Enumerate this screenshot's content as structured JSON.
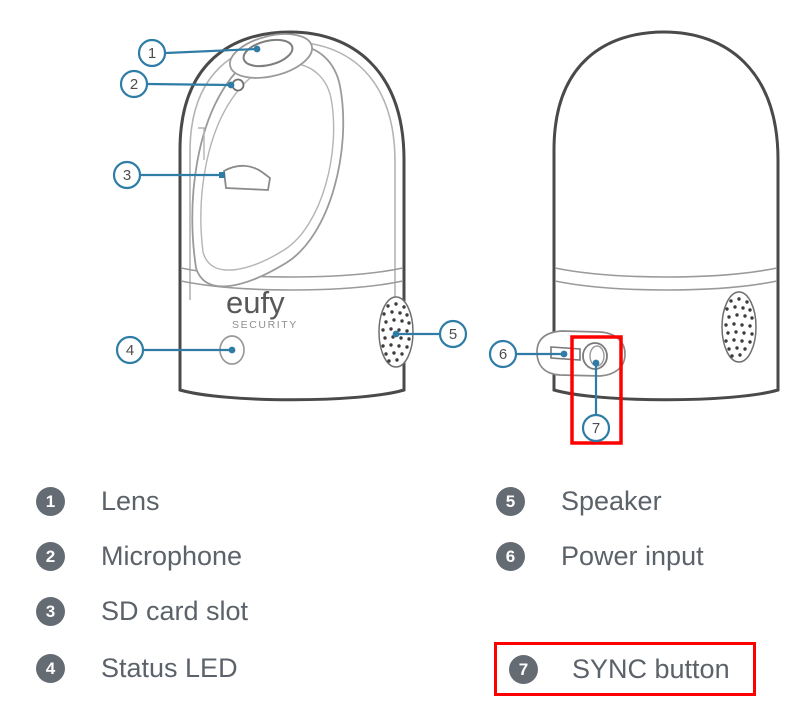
{
  "document": {
    "type": "product-parts-diagram",
    "product_brand": "eufy",
    "product_sub_brand": "SECURITY"
  },
  "colors": {
    "callout_stroke": "#2f7da6",
    "leader_line": "#2f7da6",
    "badge_bg": "#656b73",
    "badge_text": "#ffffff",
    "label_text": "#5c626a",
    "highlight_box": "#fe0000",
    "outline_dark": "#4a4a4a",
    "outline_light": "#9a9a9a",
    "background": "#ffffff"
  },
  "diagram": {
    "front_view": {
      "name": "front-view",
      "brand_text": "eufy",
      "sub_brand_text": "SECURITY",
      "callouts": [
        {
          "number": "1",
          "part": "lens"
        },
        {
          "number": "2",
          "part": "microphone"
        },
        {
          "number": "3",
          "part": "sd-card-slot"
        },
        {
          "number": "4",
          "part": "status-led"
        },
        {
          "number": "5",
          "part": "speaker"
        }
      ]
    },
    "back_view": {
      "name": "back-view",
      "callouts": [
        {
          "number": "6",
          "part": "power-input"
        },
        {
          "number": "7",
          "part": "sync-button"
        }
      ],
      "highlighted_region": "sync-button"
    }
  },
  "legend": {
    "left_column": [
      {
        "number": "1",
        "label": "Lens"
      },
      {
        "number": "2",
        "label": "Microphone"
      },
      {
        "number": "3",
        "label": "SD card slot"
      },
      {
        "number": "4",
        "label": "Status LED"
      }
    ],
    "right_column": [
      {
        "number": "5",
        "label": "Speaker",
        "highlighted": false
      },
      {
        "number": "6",
        "label": "Power input",
        "highlighted": false
      },
      {
        "number": "7",
        "label": "SYNC button",
        "highlighted": true
      }
    ]
  }
}
